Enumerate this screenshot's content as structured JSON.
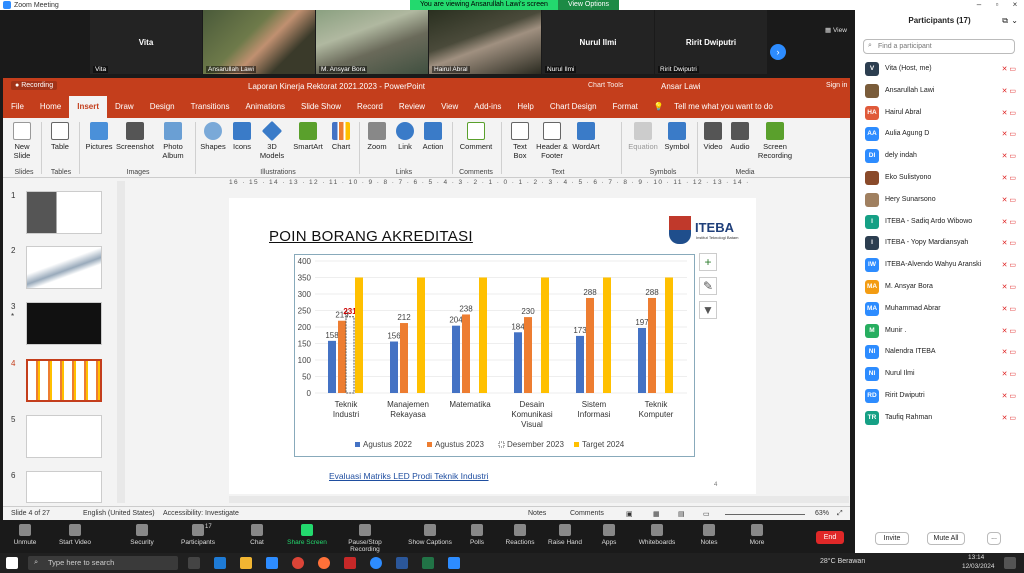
{
  "zoom": {
    "window_title": "Zoom Meeting",
    "banner_text": "You are viewing Ansarullah Lawi's screen",
    "view_options": "View Options",
    "view_label": "View",
    "tiles": [
      {
        "name": "Vita",
        "label": "Vita"
      },
      {
        "name": "",
        "label": "Ansarullah Lawi"
      },
      {
        "name": "",
        "label": "M. Ansyar Bora"
      },
      {
        "name": "",
        "label": "Hairul Abral"
      },
      {
        "name": "Nurul Ilmi",
        "label": "Nurul Ilmi"
      },
      {
        "name": "Ririt Dwiputri",
        "label": "Ririt Dwiputri"
      }
    ],
    "toolbar": [
      {
        "label": "Unmute"
      },
      {
        "label": "Start Video"
      },
      {
        "label": "Security"
      },
      {
        "label": "Participants",
        "count": "17"
      },
      {
        "label": "Chat"
      },
      {
        "label": "Share Screen"
      },
      {
        "label": "Pause/Stop Recording"
      },
      {
        "label": "Show Captions"
      },
      {
        "label": "Polls"
      },
      {
        "label": "Reactions"
      },
      {
        "label": "Raise Hand"
      },
      {
        "label": "Apps"
      },
      {
        "label": "Whiteboards"
      },
      {
        "label": "Notes"
      },
      {
        "label": "More"
      }
    ],
    "end_label": "End"
  },
  "ppt": {
    "title": "Laporan Kinerja Rektorat 2021.2023  -  PowerPoint",
    "chart_tools": "Chart Tools",
    "user": "Ansar Lawi",
    "sign_in": "Sign in",
    "recording": "Recording",
    "tabs": [
      "File",
      "Home",
      "Insert",
      "Draw",
      "Design",
      "Transitions",
      "Animations",
      "Slide Show",
      "Record",
      "Review",
      "View",
      "Add-ins",
      "Help",
      "Chart Design",
      "Format"
    ],
    "tell_me": "Tell me what you want to do",
    "ribbon": {
      "buttons": [
        "New Slide",
        "Table",
        "Pictures",
        "Screenshot",
        "Photo Album",
        "Shapes",
        "Icons",
        "3D Models",
        "SmartArt",
        "Chart",
        "Zoom",
        "Link",
        "Action",
        "Comment",
        "Text Box",
        "Header & Footer",
        "WordArt",
        "Equation",
        "Symbol",
        "Video",
        "Audio",
        "Screen Recording"
      ],
      "groups": [
        "Slides",
        "Tables",
        "Images",
        "Illustrations",
        "Links",
        "Comments",
        "Text",
        "Symbols",
        "Media"
      ]
    },
    "ruler": "16 · 15 · 14 · 13 · 12 · 11 · 10 · 9 · 8 · 7 · 6 · 5 · 4 · 3 · 2 · 1 · 0 · 1 · 2 · 3 · 4 · 5 · 6 · 7 · 8 · 9 · 10 · 11 · 12 · 13 · 14 · 15 · 16",
    "thumb_numbers": [
      "1",
      "2",
      "3",
      "4",
      "5",
      "6"
    ],
    "thumb_star": "*",
    "slide": {
      "title": "POIN BORANG AKREDITASI",
      "logo_text": "ITEBA",
      "logo_sub": "Institut Teknologi Batam",
      "link": "Evaluasi Matriks LED Prodi Teknik Industri",
      "page": "4"
    },
    "status": {
      "slide": "Slide 4 of 27",
      "language": "English (United States)",
      "accessibility": "Accessibility: Investigate",
      "notes": "Notes",
      "comments": "Comments",
      "zoom": "63%"
    },
    "colors": {
      "accent": "#c43e1c",
      "s1": "#4472c4",
      "s2": "#ed7d31",
      "s4": "#ffc000"
    }
  },
  "chart_data": {
    "type": "bar",
    "categories": [
      "Teknik Industri",
      "Manajemen Rekayasa",
      "Matematika",
      "Desain Komunikasi Visual",
      "Sistem Informasi",
      "Teknik Komputer"
    ],
    "series": [
      {
        "name": "Agustus 2022",
        "values": [
          158,
          156,
          204,
          184,
          173,
          197
        ],
        "color": "#4472c4"
      },
      {
        "name": "Agustus 2023",
        "values": [
          219,
          212,
          238,
          230,
          288,
          288
        ],
        "color": "#ed7d31"
      },
      {
        "name": "Desember 2023",
        "values": [
          231,
          null,
          null,
          null,
          null,
          null
        ],
        "color": "#bbbbbb"
      },
      {
        "name": "Target 2024",
        "values": [
          350,
          350,
          350,
          350,
          350,
          350
        ],
        "color": "#ffc000"
      }
    ],
    "ylim": [
      0,
      400
    ],
    "yticks": [
      "0",
      "50",
      "100",
      "150",
      "200",
      "250",
      "300",
      "350",
      "400"
    ],
    "grid": true,
    "legend": "bottom"
  },
  "participants": {
    "title": "Participants (17)",
    "search_placeholder": "Find a participant",
    "list": [
      {
        "initials": "V",
        "name": "Vita (Host, me)",
        "color": "#2c3e50"
      },
      {
        "initials": "",
        "name": "Ansarullah Lawi",
        "color": "#7a5c3a"
      },
      {
        "initials": "HA",
        "name": "Hairul Abral",
        "color": "#e05a3a"
      },
      {
        "initials": "AA",
        "name": "Aulia Agung D",
        "color": "#2d8cff"
      },
      {
        "initials": "DI",
        "name": "dely indah",
        "color": "#2d8cff"
      },
      {
        "initials": "",
        "name": "Eko Sulistyono",
        "color": "#8a4a2a"
      },
      {
        "initials": "",
        "name": "Hery Sunarsono",
        "color": "#a08060"
      },
      {
        "initials": "I",
        "name": "ITEBA - Sadiq Ardo Wibowo",
        "color": "#16a085"
      },
      {
        "initials": "I",
        "name": "ITEBA - Yopy Mardiansyah",
        "color": "#2c3e50"
      },
      {
        "initials": "IW",
        "name": "ITEBA-Alvendo Wahyu Aranski",
        "color": "#2d8cff"
      },
      {
        "initials": "MA",
        "name": "M. Ansyar Bora",
        "color": "#f39c12"
      },
      {
        "initials": "MA",
        "name": "Muhammad Abrar",
        "color": "#2d8cff"
      },
      {
        "initials": "M",
        "name": "Munir .",
        "color": "#27ae60"
      },
      {
        "initials": "NI",
        "name": "Nalendra ITEBA",
        "color": "#2d8cff"
      },
      {
        "initials": "NI",
        "name": "Nurul Ilmi",
        "color": "#2d8cff"
      },
      {
        "initials": "RD",
        "name": "Ririt Dwiputri",
        "color": "#2d8cff"
      },
      {
        "initials": "TR",
        "name": "Taufiq Rahman",
        "color": "#16a085"
      }
    ],
    "invite": "Invite",
    "mute_all": "Mute All",
    "more": "..."
  },
  "taskbar": {
    "search": "Type here to search",
    "weather": "28°C  Berawan",
    "time": "13:14",
    "date": "12/03/2024"
  }
}
